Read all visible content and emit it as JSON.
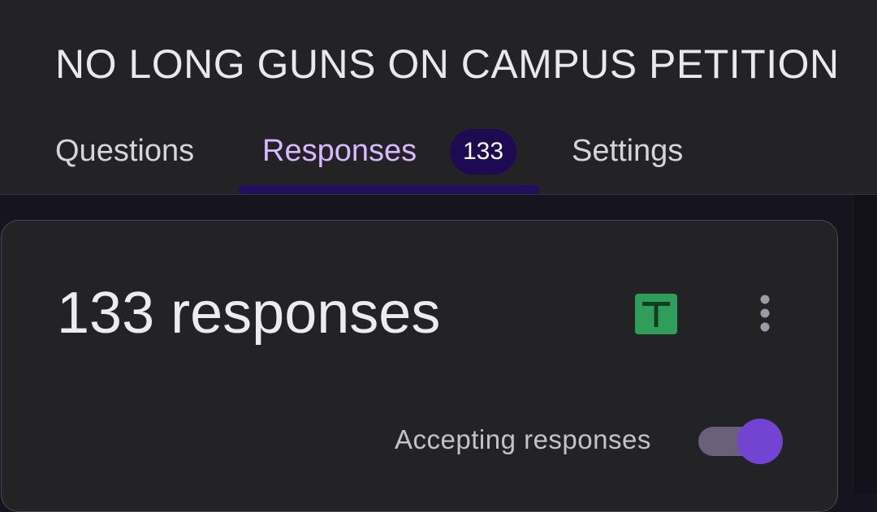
{
  "form": {
    "title": "NO LONG GUNS ON CAMPUS PETITION"
  },
  "tabs": {
    "questions": "Questions",
    "responses": "Responses",
    "responses_badge": "133",
    "settings": "Settings",
    "active": "responses"
  },
  "summary": {
    "heading": "133 responses",
    "sheets_icon": "google-sheets-icon",
    "more_icon": "more-vert-icon",
    "accepting_label": "Accepting responses",
    "accepting_enabled": true
  },
  "colors": {
    "accent": "#7244d1",
    "active_tab_text": "#d9b8ff",
    "badge_bg": "#1d0a52",
    "sheets_green": "#2f9e5b"
  }
}
